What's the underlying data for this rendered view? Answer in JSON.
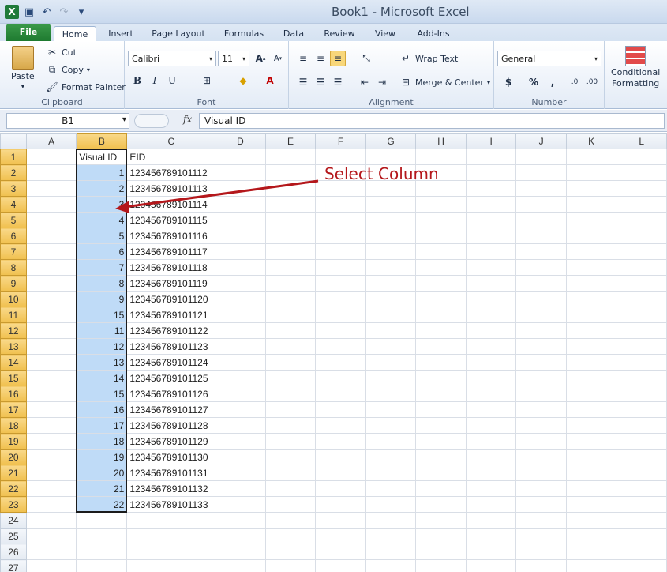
{
  "window": {
    "title": "Book1  -  Microsoft Excel"
  },
  "quick_access": [
    {
      "name": "excel-logo-icon",
      "glyph": "X"
    },
    {
      "name": "save-icon",
      "glyph": "💾"
    },
    {
      "name": "undo-icon",
      "glyph": "↶"
    },
    {
      "name": "redo-icon",
      "glyph": "↷"
    },
    {
      "name": "customize-qat-icon",
      "glyph": "▾"
    }
  ],
  "tabs": [
    "File",
    "Home",
    "Insert",
    "Page Layout",
    "Formulas",
    "Data",
    "Review",
    "View",
    "Add-Ins"
  ],
  "active_tab": "Home",
  "ribbon": {
    "clipboard": {
      "label": "Clipboard",
      "paste": "Paste",
      "cut": "Cut",
      "copy": "Copy",
      "format_painter": "Format Painter"
    },
    "font": {
      "label": "Font",
      "name": "Calibri",
      "size": "11",
      "bold": "B",
      "italic": "I",
      "underline": "U"
    },
    "alignment": {
      "label": "Alignment",
      "wrap_text": "Wrap Text",
      "merge_center": "Merge & Center"
    },
    "number": {
      "label": "Number",
      "format": "General",
      "currency": "$",
      "percent": "%",
      "comma": ","
    },
    "styles": {
      "conditional": "Conditional",
      "formatting": "Formatting"
    }
  },
  "formula_bar": {
    "name_box": "B1",
    "fx": "fx",
    "value": "Visual ID"
  },
  "sheet": {
    "columns": [
      "A",
      "B",
      "C",
      "D",
      "E",
      "F",
      "G",
      "H",
      "I",
      "J",
      "K",
      "L"
    ],
    "selected_column": "B",
    "rows": [
      {
        "n": "1",
        "b": "Visual ID",
        "c": "EID"
      },
      {
        "n": "2",
        "b": "1",
        "c": "123456789101112"
      },
      {
        "n": "3",
        "b": "2",
        "c": "123456789101113"
      },
      {
        "n": "4",
        "b": "3",
        "c": "123456789101114"
      },
      {
        "n": "5",
        "b": "4",
        "c": "123456789101115"
      },
      {
        "n": "6",
        "b": "5",
        "c": "123456789101116"
      },
      {
        "n": "7",
        "b": "6",
        "c": "123456789101117"
      },
      {
        "n": "8",
        "b": "7",
        "c": "123456789101118"
      },
      {
        "n": "9",
        "b": "8",
        "c": "123456789101119"
      },
      {
        "n": "10",
        "b": "9",
        "c": "123456789101120"
      },
      {
        "n": "11",
        "b": "15",
        "c": "123456789101121"
      },
      {
        "n": "12",
        "b": "11",
        "c": "123456789101122"
      },
      {
        "n": "13",
        "b": "12",
        "c": "123456789101123"
      },
      {
        "n": "14",
        "b": "13",
        "c": "123456789101124"
      },
      {
        "n": "15",
        "b": "14",
        "c": "123456789101125"
      },
      {
        "n": "16",
        "b": "15",
        "c": "123456789101126"
      },
      {
        "n": "17",
        "b": "16",
        "c": "123456789101127"
      },
      {
        "n": "18",
        "b": "17",
        "c": "123456789101128"
      },
      {
        "n": "19",
        "b": "18",
        "c": "123456789101129"
      },
      {
        "n": "20",
        "b": "19",
        "c": "123456789101130"
      },
      {
        "n": "21",
        "b": "20",
        "c": "123456789101131"
      },
      {
        "n": "22",
        "b": "21",
        "c": "123456789101132"
      },
      {
        "n": "23",
        "b": "22",
        "c": "123456789101133"
      },
      {
        "n": "24",
        "b": "",
        "c": ""
      },
      {
        "n": "25",
        "b": "",
        "c": ""
      },
      {
        "n": "26",
        "b": "",
        "c": ""
      },
      {
        "n": "27",
        "b": "",
        "c": ""
      }
    ]
  },
  "annotation": {
    "text": "Select Column",
    "color": "#b4171b"
  },
  "colors": {
    "selection": "#bfdbf7",
    "header_highlight": "#f0c04f",
    "file_tab": "#1e7a30"
  }
}
